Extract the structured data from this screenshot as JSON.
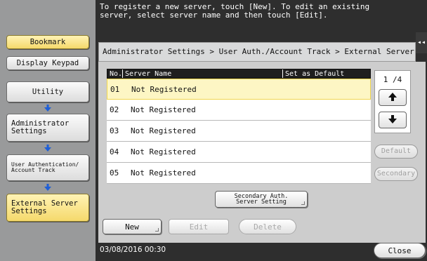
{
  "message": "To register a new server, touch [New]. To edit an existing server, select server name and then touch [Edit].",
  "left_panel": {
    "bookmark": "Bookmark",
    "display_keypad": "Display Keypad",
    "utility": "Utility",
    "administrator_settings": "Administrator Settings",
    "user_auth": "User Authentication/ Account Track",
    "external_server_settings": "External Server Settings"
  },
  "breadcrumb": "Administrator Settings > User Auth./Account Track > External Server Setting",
  "collapse_tab_icon": "double-chevron-left-icon",
  "table": {
    "headers": {
      "no": "No.",
      "name": "Server Name",
      "default": "Set as Default"
    },
    "rows": [
      {
        "no": "01",
        "name": "Not Registered"
      },
      {
        "no": "02",
        "name": "Not Registered"
      },
      {
        "no": "03",
        "name": "Not Registered"
      },
      {
        "no": "04",
        "name": "Not Registered"
      },
      {
        "no": "05",
        "name": "Not Registered"
      }
    ]
  },
  "pager": {
    "page": "1 /4"
  },
  "side_buttons": {
    "default": "Default",
    "secondary": "Secondary"
  },
  "secondary_auth_button": "Secondary Auth. Server Setting",
  "bottom_buttons": {
    "new": "New",
    "edit": "Edit",
    "delete": "Delete"
  },
  "close_button": "Close",
  "datetime": "03/08/2016  00:30",
  "colors": {
    "accent_yellow": "#f5d96b",
    "arrow_blue": "#1f5fd6",
    "dark_bg": "#2e2e2e",
    "left_panel": "#999a9b"
  }
}
